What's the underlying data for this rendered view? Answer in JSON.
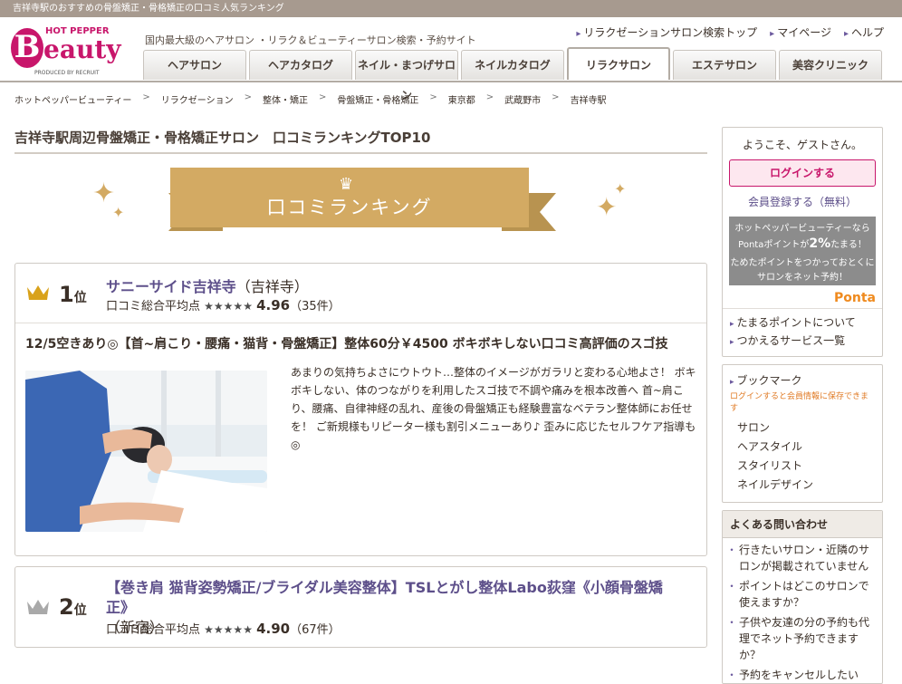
{
  "topstrip": "吉祥寺駅のおすすめの骨盤矯正・骨格矯正の口コミ人気ランキング",
  "logo": {
    "hotpepper": "HOT PEPPER",
    "initial": "B",
    "word": "eauty",
    "produced": "PRODUCED BY RECRUIT"
  },
  "tagline": "国内最大級のヘアサロン ・リラク＆ビューティーサロン検索・予約サイト",
  "toplinks": [
    "リラクゼーションサロン検索トップ",
    "マイページ",
    "ヘルプ"
  ],
  "tabs": [
    "ヘアサロン",
    "ヘアカタログ",
    "ネイル・まつげサロン",
    "ネイルカタログ",
    "リラクサロン",
    "エステサロン",
    "美容クリニック"
  ],
  "active_tab": "リラクサロン",
  "breadcrumbs": [
    "ホットペッパービューティー",
    "リラクゼーション",
    "整体・矯正",
    "骨盤矯正・骨格矯正",
    "東京都",
    "武蔵野市",
    "吉祥寺駅"
  ],
  "page_title": "吉祥寺駅周辺骨盤矯正・骨格矯正サロン　口コミランキングTOP10",
  "ribbon_label": "口コミランキング",
  "ranking": [
    {
      "rank": "1",
      "rank_suffix": "位",
      "name": "サニーサイド吉祥寺",
      "area": "（吉祥寺）",
      "rating_label": "口コミ総合平均点",
      "stars": "★★★★★",
      "score": "4.96",
      "count": "（35件）",
      "catch": "12/5空きあり◎【首~肩こり・腰痛・猫背・骨盤矯正】整体60分￥4500 ボキボキしない口コミ高評価のスゴ技",
      "description": "あまりの気持ちよさにウトウト…整体のイメージがガラリと変わる心地よさ！ ボキボキしない、体のつながりを利用したスゴ技で不調や痛みを根本改善へ 首~肩こり、腰痛、自律神経の乱れ、産後の骨盤矯正も経験豊富なベテラン整体師にお任せを！ ご新規様もリピーター様も割引メニューあり♪ 歪みに応じたセルフケア指導も◎"
    },
    {
      "rank": "2",
      "rank_suffix": "位",
      "name": "【巻き肩 猫背姿勢矯正/ブライダル美容整体】TSLとがし整体Labo荻窪《小顔骨盤矯正》",
      "area": "（新宿）",
      "rating_label": "口コミ総合平均点",
      "stars": "★★★★★",
      "score": "4.90",
      "count": "（67件）"
    }
  ],
  "sidebar": {
    "welcome": "ようこそ、ゲストさん。",
    "login": "ログインする",
    "register": "会員登録する（無料）",
    "ponta_line1": "ホットペッパービューティーなら",
    "ponta_line2a": "Pontaポイントが",
    "ponta_pct": "2%",
    "ponta_line2b": "たまる！",
    "ponta_line3": "ためたポイントをつかっておとくにサロンをネット予約！",
    "ponta_logo": "Ponta",
    "point_links": [
      "たまるポイントについて",
      "つかえるサービス一覧"
    ],
    "bookmark_title": "ブックマーク",
    "bookmark_note": "ログインすると会員情報に保存できます",
    "bookmark_items": [
      "サロン",
      "ヘアスタイル",
      "スタイリスト",
      "ネイルデザイン"
    ],
    "faq_title": "よくある問い合わせ",
    "faq": [
      "行きたいサロン・近隣のサロンが掲載されていません",
      "ポイントはどこのサロンで使えますか？",
      "子供や友達の分の予約も代理でネット予約できますか？",
      "予約をキャンセルしたい"
    ]
  },
  "colors": {
    "brand": "#c8166b",
    "gold": "#d3aa63",
    "link": "#5d4f8a"
  }
}
